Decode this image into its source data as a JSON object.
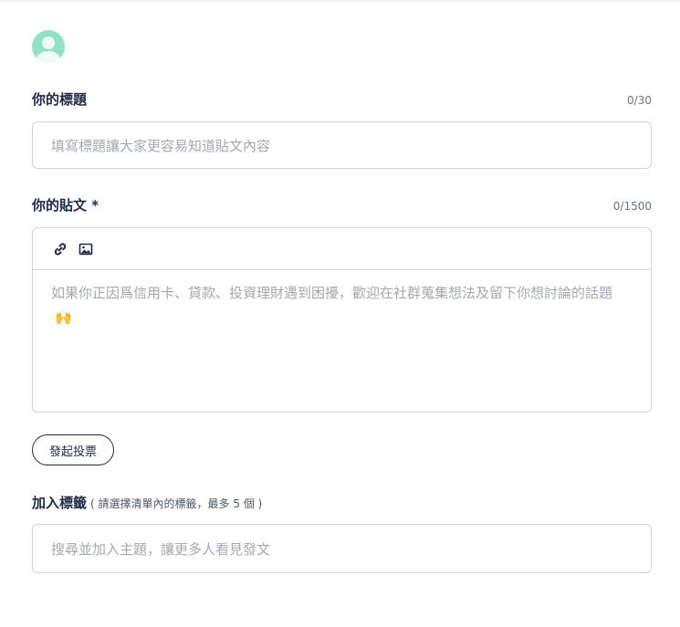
{
  "title_field": {
    "label": "你的標題",
    "counter": "0/30",
    "placeholder": "填寫標題讓大家更容易知道貼文內容"
  },
  "post_field": {
    "label": "你的貼文 *",
    "counter": "0/1500",
    "placeholder": "如果你正因爲信用卡、貸款、投資理財遇到困擾，歡迎在社群蒐集想法及留下你想討論的話題",
    "emoji": "🙌",
    "toolbar": {
      "link_icon": "link-icon",
      "image_icon": "image-icon"
    }
  },
  "poll_button": {
    "label": "發起投票"
  },
  "tags_field": {
    "label": "加入標籤",
    "hint": "( 請選擇清單內的標籤，最多 5 個 )",
    "placeholder": "搜尋並加入主題，讓更多人看見發文"
  },
  "colors": {
    "avatar": "#8fe3c4",
    "text_primary": "#1f2a44",
    "placeholder": "#a3a8b2",
    "border": "#d1d5db"
  }
}
